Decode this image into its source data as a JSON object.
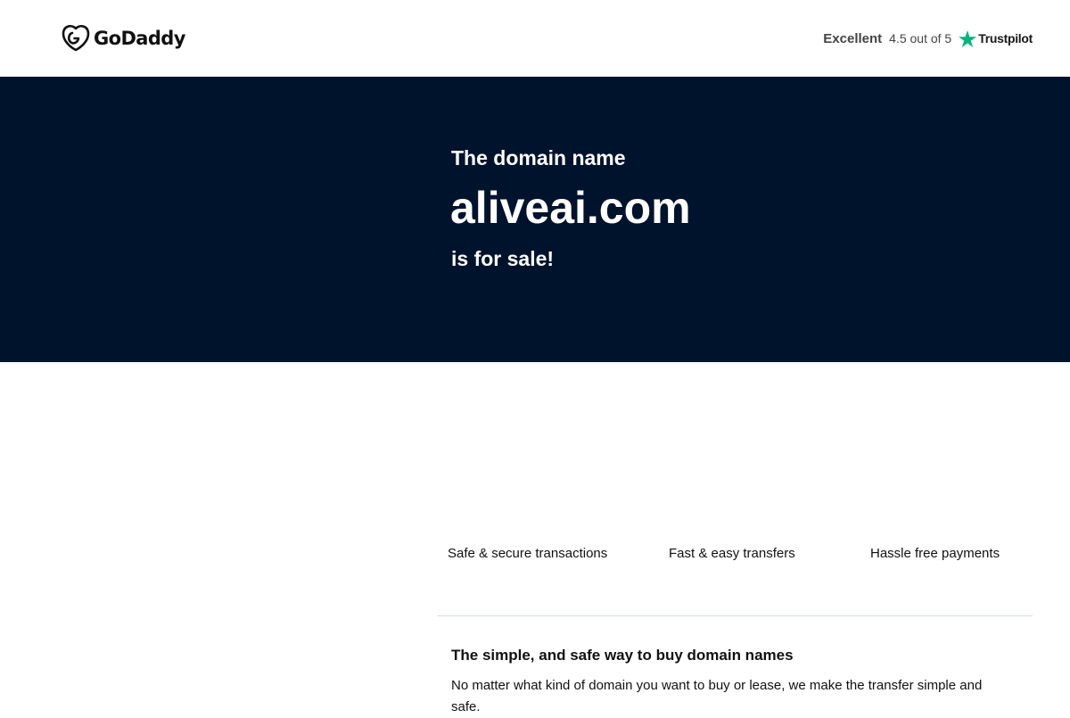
{
  "header": {
    "logo_text": "GoDaddy",
    "rating_label": "Excellent",
    "rating_score": "4.5 out of 5",
    "trustpilot_label": "Trustpilot",
    "trustpilot_star_color": "#00b67a"
  },
  "hero": {
    "intro": "The domain name",
    "domain": "aliveai.com",
    "status": "is for sale!",
    "background_color": "#00132d"
  },
  "features": [
    {
      "label": "Safe & secure transactions"
    },
    {
      "label": "Fast & easy transfers"
    },
    {
      "label": "Hassle free payments"
    }
  ],
  "info": {
    "title": "The simple, and safe way to buy domain names",
    "body": "No matter what kind of domain you want to buy or lease, we make the transfer simple and safe."
  },
  "icons": {
    "logo": "godaddy-logo-icon",
    "rating_star": "trustpilot-star-icon"
  }
}
